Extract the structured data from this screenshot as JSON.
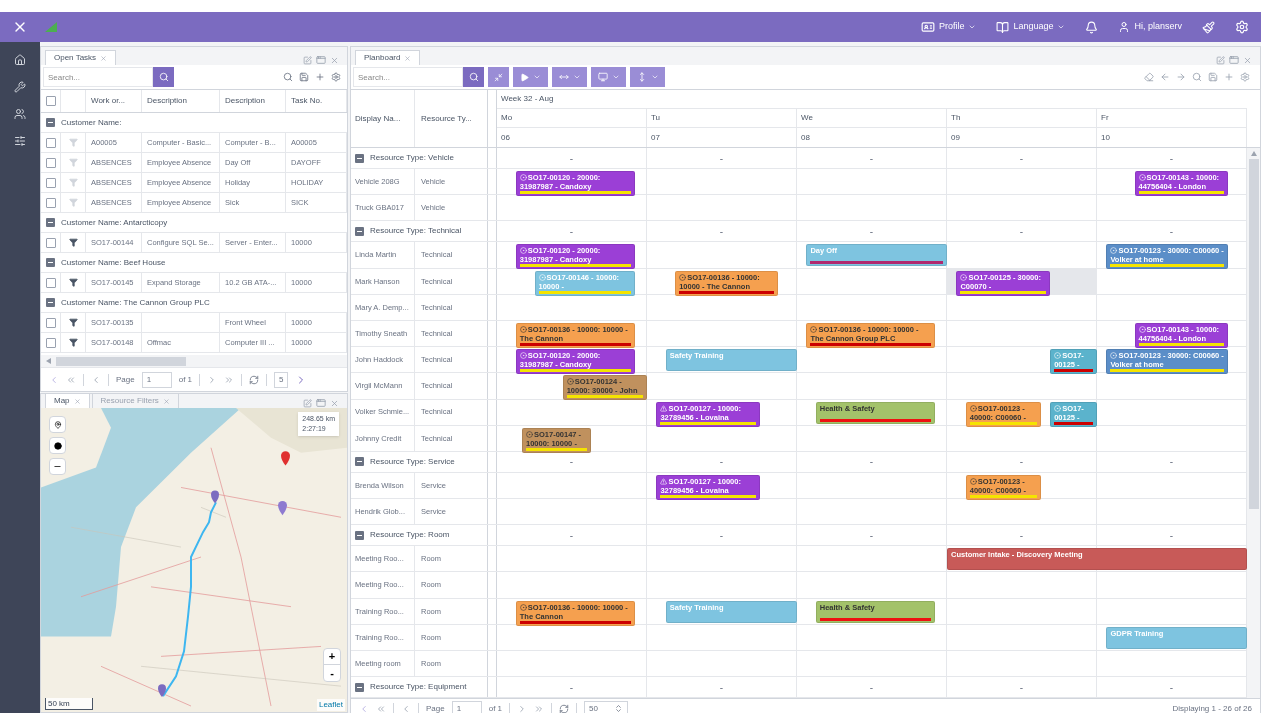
{
  "topbar": {
    "menus": [
      {
        "label": "Profile",
        "kind": "profile"
      },
      {
        "label": "Language",
        "kind": "language"
      }
    ],
    "user": "Hi, planserv"
  },
  "open_tasks": {
    "tab": "Open Tasks",
    "search_placeholder": "Search...",
    "select_all_checked": false,
    "columns": [
      "Work or...",
      "Description",
      "Description",
      "Task No."
    ],
    "groups": [
      {
        "label": "Customer Name:",
        "expanded": true,
        "rows": [
          {
            "checked": false,
            "filter_active": false,
            "cells": [
              "A00005",
              "Computer - Basic...",
              "Computer - B...",
              "A00005"
            ]
          },
          {
            "checked": false,
            "filter_active": false,
            "cells": [
              "ABSENCES",
              "Employee Absence",
              "Day Off",
              "DAYOFF"
            ]
          },
          {
            "checked": false,
            "filter_active": false,
            "cells": [
              "ABSENCES",
              "Employee Absence",
              "Holiday",
              "HOLIDAY"
            ]
          },
          {
            "checked": false,
            "filter_active": false,
            "cells": [
              "ABSENCES",
              "Employee Absence",
              "Sick",
              "SICK"
            ]
          }
        ]
      },
      {
        "label": "Customer Name: Antarcticopy",
        "expanded": true,
        "rows": [
          {
            "checked": false,
            "filter_active": true,
            "cells": [
              "SO17-00144",
              "Configure SQL Se...",
              "Server - Enter...",
              "10000"
            ]
          }
        ]
      },
      {
        "label": "Customer Name: Beef House",
        "expanded": true,
        "rows": [
          {
            "checked": false,
            "filter_active": true,
            "cells": [
              "SO17-00145",
              "Expand Storage",
              "10.2 GB ATA-...",
              "10000"
            ]
          }
        ]
      },
      {
        "label": "Customer Name: The Cannon Group PLC",
        "expanded": true,
        "rows": [
          {
            "checked": false,
            "filter_active": true,
            "cells": [
              "SO17-00135",
              "",
              "Front Wheel",
              "10000"
            ]
          },
          {
            "checked": false,
            "filter_active": true,
            "cells": [
              "SO17-00148",
              "Offmac",
              "Computer III ...",
              "10000"
            ]
          }
        ]
      }
    ],
    "pager": {
      "page_label": "Page",
      "page": "1",
      "of": "of 1",
      "page_size": "5"
    }
  },
  "map_panel": {
    "tabs": [
      {
        "label": "Map",
        "selected": true
      },
      {
        "label": "Resource Filters",
        "selected": false
      }
    ],
    "route_info": [
      "248.65 km",
      "2:27:19"
    ],
    "zoom_in": "+",
    "zoom_out": "-",
    "scale": "50 km",
    "attribution": "Leaflet"
  },
  "planboard": {
    "tab": "Planboard",
    "search_placeholder": "Search...",
    "columns": [
      "Display Na...",
      "Resource Ty..."
    ],
    "week": "Week 32 - Aug",
    "days": [
      {
        "name": "Mo",
        "date": "06"
      },
      {
        "name": "Tu",
        "date": "07"
      },
      {
        "name": "We",
        "date": "08"
      },
      {
        "name": "Th",
        "date": "09"
      },
      {
        "name": "Fr",
        "date": "10"
      }
    ],
    "groups": [
      {
        "label": "Resource Type: Vehicle",
        "expanded": true,
        "day_marks": [
          "-",
          "-",
          "-",
          "-",
          "-"
        ],
        "rows": [
          {
            "name": "Vehicle 208G",
            "type": "Vehicle",
            "highlighted": false,
            "events": [
              {
                "label": "SO17-00120 - 20000: 31987987 - Candoxy",
                "kind": "target",
                "color": "#9b3fd6",
                "stripe": {
                  "color": "#f5e400"
                }
              },
              {
                "label": "SO17-00143 - 10000: 44756404 - London",
                "kind": "target",
                "color": "#9b3fd6",
                "stripe": {
                  "color": "#f5e400"
                }
              }
            ]
          },
          {
            "name": "Truck GBA017",
            "type": "Vehicle",
            "highlighted": false
          }
        ]
      },
      {
        "label": "Resource Type: Technical",
        "expanded": true,
        "day_marks": [
          "-",
          "-",
          "-",
          "-",
          "-"
        ],
        "rows": [
          {
            "name": "Linda Martin",
            "type": "Technical",
            "highlighted": false,
            "events": [
              {
                "label": "SO17-00120 - 20000: 31987987 - Candoxy",
                "kind": "target",
                "color": "#9b3fd6",
                "stripe": {
                  "color": "#f5e400"
                }
              },
              {
                "label": "Day Off",
                "kind": "plain",
                "color": "#7ec4e0",
                "stripe": {
                  "color": "#b0286e"
                }
              },
              {
                "label": "SO17-00123 - 30000: C00060 - Volker at home",
                "kind": "target",
                "color": "#5b8ec8",
                "stripe": {
                  "color": "#f5e400"
                }
              }
            ]
          },
          {
            "name": "Mark Hanson",
            "type": "Technical",
            "highlighted": true,
            "events": [
              {
                "label": "SO17-00146 - 10000: 10000 -",
                "kind": "target",
                "color": "#7ec4e0",
                "stripe": {
                  "color": "#f5e400"
                }
              },
              {
                "label": "SO17-00136 - 10000: 10000 - The Cannon",
                "kind": "target",
                "color": "#f5a04f",
                "stripe": {
                  "color": "#cc0000"
                }
              },
              {
                "label": "SO17-00125 - 30000: C00070 -",
                "kind": "target",
                "color": "#9b3fd6",
                "stripe": {
                  "color": "#f5e400"
                }
              }
            ]
          },
          {
            "name": "Mary A. Demp...",
            "type": "Technical",
            "highlighted": false
          },
          {
            "name": "Timothy Sneath",
            "type": "Technical",
            "highlighted": false,
            "events": [
              {
                "label": "SO17-00136 - 10000: 10000 - The Cannon",
                "kind": "target",
                "color": "#f5a04f",
                "stripe": {
                  "color": "#cc0000"
                }
              },
              {
                "label": "SO17-00136 - 10000: 10000 - The Cannon Group PLC",
                "kind": "target",
                "color": "#f5a04f",
                "stripe": {
                  "color": "#cc0000"
                }
              },
              {
                "label": "SO17-00143 - 10000: 44756404 - London",
                "kind": "target",
                "color": "#9b3fd6",
                "stripe": {
                  "color": "#f5e400"
                }
              }
            ]
          },
          {
            "name": "John Haddock",
            "type": "Technical",
            "highlighted": false,
            "events": [
              {
                "label": "SO17-00120 - 20000: 31987987 - Candoxy",
                "kind": "target",
                "color": "#9b3fd6",
                "stripe": {
                  "color": "#f5e400"
                }
              },
              {
                "label": "Safety Training",
                "kind": "plain",
                "color": "#7ec4e0"
              },
              {
                "label": "SO17-00125 -",
                "kind": "target",
                "color": "#5bb3cc",
                "stripe": {
                  "color": "#cc0000"
                }
              },
              {
                "label": "SO17-00123 - 30000: C00060 - Volker at home",
                "kind": "target",
                "color": "#5b8ec8",
                "stripe": {
                  "color": "#f5e400"
                }
              }
            ]
          },
          {
            "name": "Virgil McMann",
            "type": "Technical",
            "highlighted": false,
            "events": [
              {
                "label": "SO17-00124 - 10000: 30000 - John",
                "kind": "target",
                "color": "#c0915e",
                "stripe": {
                  "color": "#f5e400"
                }
              }
            ]
          },
          {
            "name": "Volker Schmie...",
            "type": "Technical",
            "highlighted": false,
            "events": [
              {
                "label": "SO17-00127 - 10000: 32789456 - Lovaina",
                "kind": "warning",
                "color": "#9b3fd6",
                "stripe": {
                  "color": "#f5e400"
                }
              },
              {
                "label": "Health & Safety",
                "kind": "plain",
                "color": "#a3c26a",
                "stripe": {
                  "color": "#ee1111"
                }
              },
              {
                "label": "SO17-00123 - 40000: C00060 -",
                "kind": "target",
                "color": "#f5a04f",
                "stripe": {
                  "color": "#f5e400"
                }
              },
              {
                "label": "SO17-00125 -",
                "kind": "target",
                "color": "#5bb3cc",
                "stripe": {
                  "color": "#cc0000"
                }
              }
            ]
          },
          {
            "name": "Johnny Credit",
            "type": "Technical",
            "highlighted": false,
            "events": [
              {
                "label": "SO17-00147 - 10000: 10000 -",
                "kind": "target",
                "color": "#c0915e",
                "stripe": {
                  "color": "#f5e400"
                }
              }
            ]
          }
        ]
      },
      {
        "label": "Resource Type: Service",
        "expanded": true,
        "day_marks": [
          "-",
          "-",
          "-",
          "-",
          "-"
        ],
        "rows": [
          {
            "name": "Brenda Wilson",
            "type": "Service",
            "highlighted": false,
            "events": [
              {
                "label": "SO17-00127 - 10000: 32789456 - Lovaina",
                "kind": "warning",
                "color": "#9b3fd6",
                "stripe": {
                  "color": "#f5e400"
                }
              },
              {
                "label": "SO17-00123 - 40000: C00060 -",
                "kind": "target",
                "color": "#f5a04f",
                "stripe": {
                  "color": "#f5e400"
                }
              }
            ]
          },
          {
            "name": "Hendrik Glob...",
            "type": "Service",
            "highlighted": false
          }
        ]
      },
      {
        "label": "Resource Type: Room",
        "expanded": true,
        "day_marks": [
          "-",
          "-",
          "-",
          "-",
          "-"
        ],
        "rows": [
          {
            "name": "Meeting Roo...",
            "type": "Room",
            "highlighted": false,
            "events": [
              {
                "label": "Customer Intake - Discovery Meeting",
                "kind": "plain",
                "color": "#c85a58"
              }
            ]
          },
          {
            "name": "Meeting Roo...",
            "type": "Room",
            "highlighted": false
          },
          {
            "name": "Training Roo...",
            "type": "Room",
            "highlighted": false,
            "events": [
              {
                "label": "SO17-00136 - 10000: 10000 - The Cannon",
                "kind": "target",
                "color": "#f5a04f",
                "stripe": {
                  "color": "#cc0000"
                }
              },
              {
                "label": "Safety Training",
                "kind": "plain",
                "color": "#7ec4e0"
              },
              {
                "label": "Health & Safety",
                "kind": "plain",
                "color": "#a3c26a",
                "stripe": {
                  "color": "#ee1111"
                }
              }
            ]
          },
          {
            "name": "Training Roo...",
            "type": "Room",
            "highlighted": false,
            "events": [
              {
                "label": "GDPR Training",
                "kind": "plain",
                "color": "#7ec4e0"
              }
            ]
          },
          {
            "name": "Meeting room",
            "type": "Room",
            "highlighted": false
          }
        ]
      },
      {
        "label": "Resource Type: Equipment",
        "expanded": true,
        "day_marks": [
          "-",
          "-",
          "-",
          "-",
          "-"
        ]
      }
    ],
    "pager": {
      "page_label": "Page",
      "page": "1",
      "of": "of 1",
      "page_size": "50"
    },
    "displaying": "Displaying 1 - 26 of 26"
  }
}
